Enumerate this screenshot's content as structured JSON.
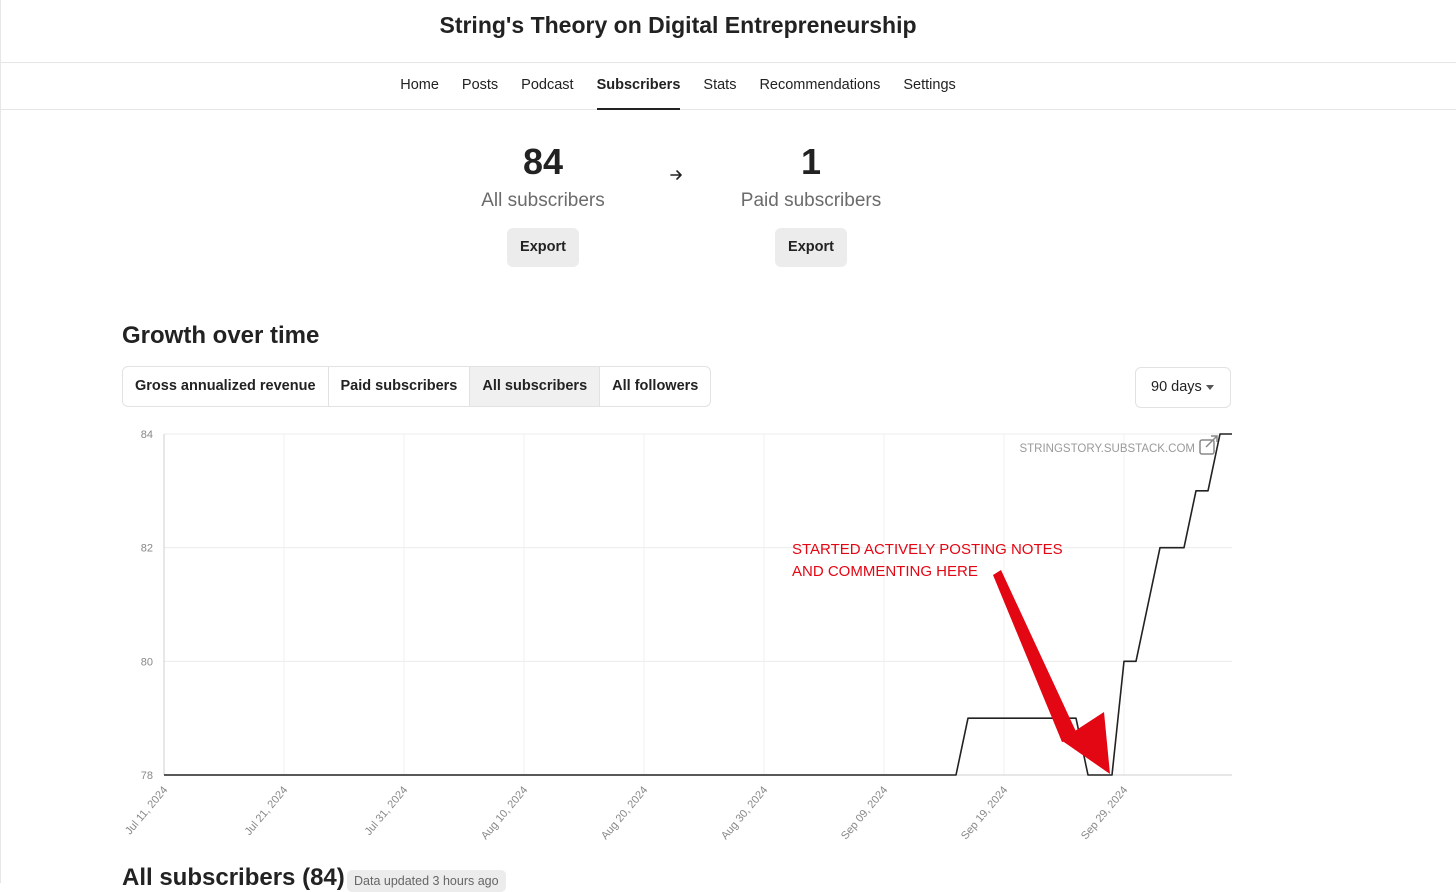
{
  "header": {
    "title": "String's Theory on Digital Entrepreneurship"
  },
  "nav": {
    "tabs": [
      "Home",
      "Posts",
      "Podcast",
      "Subscribers",
      "Stats",
      "Recommendations",
      "Settings"
    ],
    "active": "Subscribers"
  },
  "stats": {
    "all": {
      "value": "84",
      "label": "All subscribers",
      "button": "Export"
    },
    "paid": {
      "value": "1",
      "label": "Paid subscribers",
      "button": "Export"
    },
    "arrow_icon": "arrow-right-icon"
  },
  "growth": {
    "title": "Growth over time",
    "options": [
      "Gross annualized revenue",
      "Paid subscribers",
      "All subscribers",
      "All followers"
    ],
    "active_option": "All subscribers",
    "range": "90 days"
  },
  "chart_data": {
    "type": "line",
    "watermark": "STRINGSTORY.SUBSTACK.COM",
    "annotation": [
      "STARTED ACTIVELY POSTING NOTES",
      "AND COMMENTING HERE"
    ],
    "annotation_color": "#e30613",
    "line_color": "#222222",
    "grid": true,
    "ylim": [
      78,
      84
    ],
    "yticks": [
      78,
      80,
      82,
      84
    ],
    "xticks": [
      "Jul 11, 2024",
      "Jul 21, 2024",
      "Jul 31, 2024",
      "Aug 10, 2024",
      "Aug 20, 2024",
      "Aug 30, 2024",
      "Sep 09, 2024",
      "Sep 19, 2024",
      "Sep 29, 2024"
    ],
    "series": [
      {
        "points": [
          [
            "2024-07-11",
            78
          ],
          [
            "2024-09-15",
            78
          ],
          [
            "2024-09-16",
            79
          ],
          [
            "2024-09-21",
            79
          ],
          [
            "2024-09-22",
            79
          ],
          [
            "2024-09-25",
            79
          ],
          [
            "2024-09-26",
            78
          ],
          [
            "2024-09-28",
            78
          ],
          [
            "2024-09-29",
            80
          ],
          [
            "2024-09-30",
            80
          ],
          [
            "2024-10-01",
            81
          ],
          [
            "2024-10-02",
            82
          ],
          [
            "2024-10-04",
            82
          ],
          [
            "2024-10-05",
            83
          ],
          [
            "2024-10-06",
            83
          ],
          [
            "2024-10-07",
            84
          ],
          [
            "2024-10-08",
            84
          ]
        ]
      }
    ]
  },
  "subscribers_section": {
    "title": "All subscribers (84)",
    "badge": "Data updated 3 hours ago"
  }
}
